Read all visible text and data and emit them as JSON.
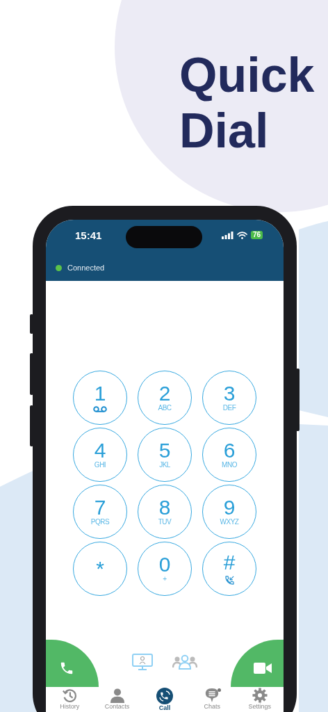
{
  "headline": [
    "Quick",
    "Dial"
  ],
  "status_bar": {
    "time": "15:41",
    "battery": "76"
  },
  "connection": {
    "label": "Connected",
    "connected": true
  },
  "keypad": [
    {
      "digit": "1",
      "kind": "voicemail"
    },
    {
      "digit": "2",
      "letters": "ABC"
    },
    {
      "digit": "3",
      "letters": "DEF"
    },
    {
      "digit": "4",
      "letters": "GHI"
    },
    {
      "digit": "5",
      "letters": "JKL"
    },
    {
      "digit": "6",
      "letters": "MNO"
    },
    {
      "digit": "7",
      "letters": "PQRS"
    },
    {
      "digit": "8",
      "letters": "TUV"
    },
    {
      "digit": "9",
      "letters": "WXYZ"
    },
    {
      "digit": "*"
    },
    {
      "digit": "0",
      "letters": "+"
    },
    {
      "digit": "#",
      "kind": "forward"
    }
  ],
  "tabs": [
    {
      "label": "History",
      "kind": "history",
      "selected": false,
      "unread": false
    },
    {
      "label": "Contacts",
      "kind": "contacts",
      "selected": false,
      "unread": false
    },
    {
      "label": "Call",
      "kind": "call",
      "selected": true,
      "unread": false
    },
    {
      "label": "Chats",
      "kind": "chats",
      "selected": false,
      "unread": true
    },
    {
      "label": "Settings",
      "kind": "settings",
      "selected": false,
      "unread": false
    }
  ]
}
